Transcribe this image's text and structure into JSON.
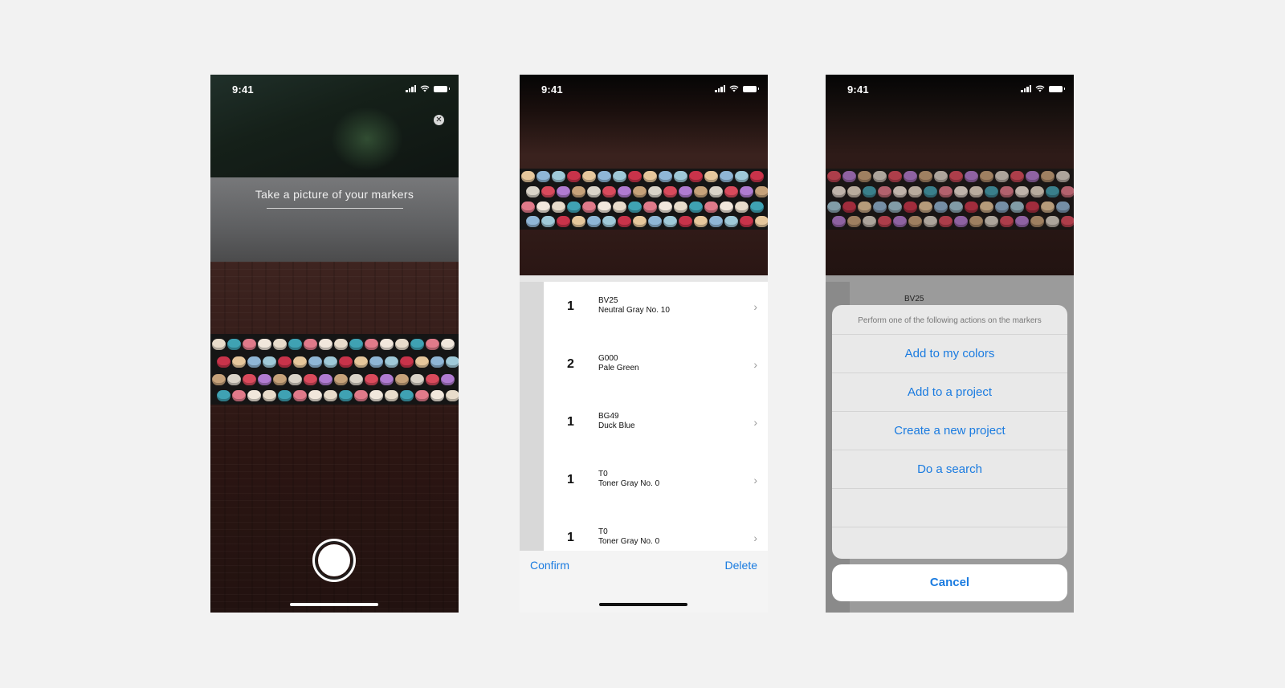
{
  "status_bar": {
    "time": "9:41"
  },
  "camera_screen": {
    "prompt": "Take a picture of your markers",
    "close_icon": "close-circle-icon",
    "shutter_icon": "shutter-icon"
  },
  "review_screen": {
    "items": [
      {
        "qty": "1",
        "code": "BV25",
        "name": "Neutral Gray No. 10"
      },
      {
        "qty": "2",
        "code": "G000",
        "name": "Pale Green"
      },
      {
        "qty": "1",
        "code": "BG49",
        "name": "Duck Blue"
      },
      {
        "qty": "1",
        "code": "T0",
        "name": "Toner Gray No. 0"
      },
      {
        "qty": "1",
        "code": "T0",
        "name": "Toner Gray No. 0"
      }
    ],
    "confirm_label": "Confirm",
    "delete_label": "Delete"
  },
  "action_sheet_screen": {
    "background_code": "BV25",
    "title": "Perform one of the following actions on the markers",
    "actions": [
      "Add to my colors",
      "Add to a project",
      "Create a new project",
      "Do a search"
    ],
    "cancel_label": "Cancel"
  },
  "colors": {
    "accent": "#1a7be0",
    "page_bg": "#f2f2f2"
  }
}
